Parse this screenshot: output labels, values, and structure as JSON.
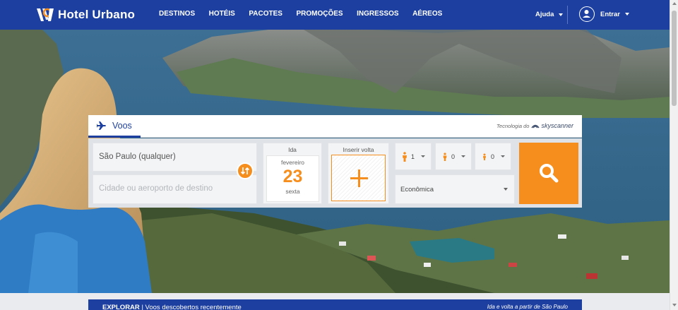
{
  "header": {
    "brand": "Hotel Urbano",
    "nav": [
      "DESTINOS",
      "HOTÉIS",
      "PACOTES",
      "PROMOÇÕES",
      "INGRESSOS",
      "AÉREOS"
    ],
    "help_label": "Ajuda",
    "login_label": "Entrar"
  },
  "search": {
    "tab_label": "Voos",
    "powered_by": "Tecnologia do",
    "powered_brand": "skyscanner",
    "origin_value": "São Paulo (qualquer)",
    "destination_placeholder": "Cidade ou aeroporto de destino",
    "departure": {
      "label": "Ida",
      "month": "fevereiro",
      "day": "23",
      "weekday": "sexta"
    },
    "return_label": "Inserir volta",
    "passengers": {
      "adults": "1",
      "children": "0",
      "babies": "0"
    },
    "cabin_class": "Econômica",
    "icons": [
      "plane-icon",
      "swap-icon",
      "plus-icon",
      "adult-icon",
      "child-icon",
      "baby-icon",
      "search-icon"
    ]
  },
  "explore": {
    "label": "EXPLORAR",
    "subtitle": "Voos descobertos recentemente",
    "right_text": "Ida e volta a partir de São Paulo"
  },
  "colors": {
    "brand_blue": "#1d3fa0",
    "accent_orange": "#f68e1e"
  }
}
